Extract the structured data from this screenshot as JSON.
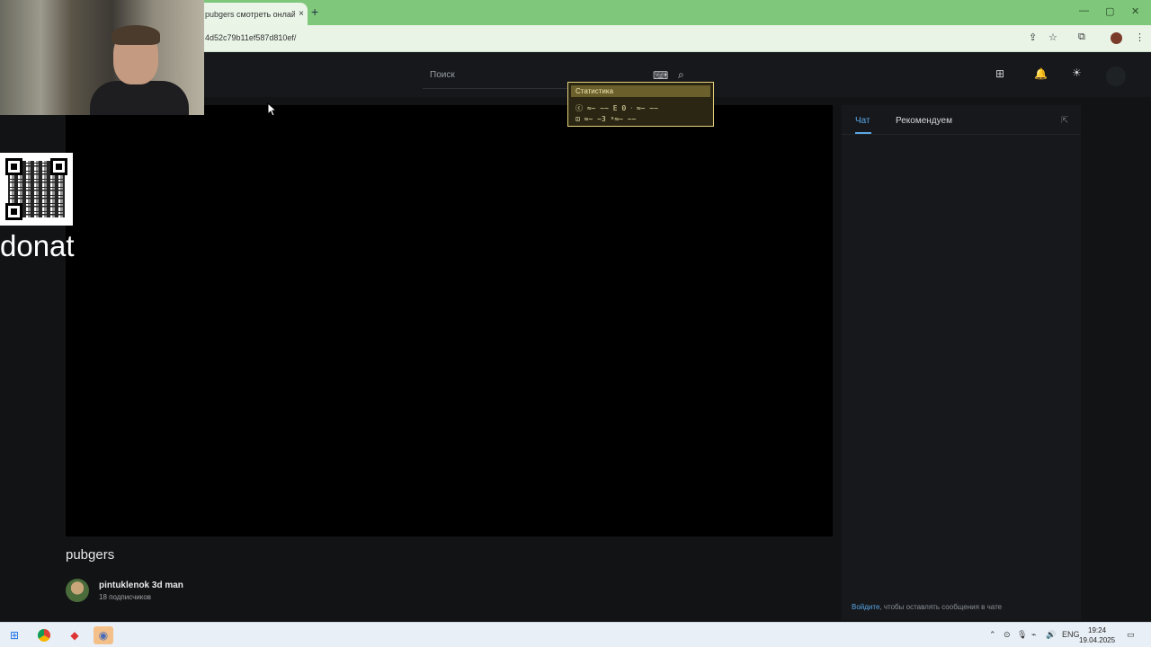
{
  "browser": {
    "tab_title": "pubgers смотреть онлай",
    "tab_close": "×",
    "new_tab": "+",
    "url": "4d52c79b11ef587d810ef/",
    "window_controls": [
      "—",
      "▢",
      "✕"
    ]
  },
  "site": {
    "search_placeholder": "Поиск"
  },
  "stats_overlay": {
    "title": "Статистика",
    "row1": "ⓒ ≈~ ~~ E 0  ᐧ ≈~ ~~",
    "row2": "⊡ ≈~ ~3 ᵃ≈~ ~~"
  },
  "chat": {
    "tabs": [
      {
        "label": "Чат",
        "active": true
      },
      {
        "label": "Рекомендуем",
        "active": false
      }
    ],
    "login_link": "Войдите",
    "login_text": ", чтобы оставлять сообщения в чате"
  },
  "stream": {
    "title": "pubgers",
    "channel_name": "pintuklenok 3d man",
    "subscribers": "18 подписчиков"
  },
  "overlay": {
    "donate_text": "donat"
  },
  "taskbar": {
    "lang": "ENG",
    "time": "19:24",
    "date": "19.04.2025"
  },
  "colors": {
    "accent": "#5aa7e6",
    "tabbar": "#7fc77a",
    "background": "#111315"
  }
}
